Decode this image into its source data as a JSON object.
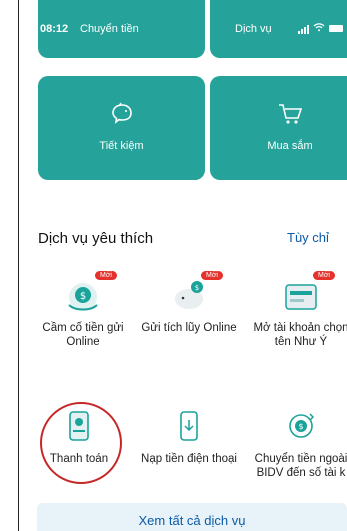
{
  "status_bar": {
    "time": "08:12",
    "left_app": "Chuyển tiền",
    "right_app": "Dịch vụ"
  },
  "tiles": [
    {
      "label": "Tiết kiệm",
      "icon": "piggy-bank-icon"
    },
    {
      "label": "Mua sắm",
      "icon": "shopping-cart-icon"
    }
  ],
  "favorites": {
    "title": "Dịch vụ yêu thích",
    "customize_label": "Tùy chỉ",
    "items": [
      {
        "label": "Cầm cố tiền gửi Online",
        "badge": "Mới",
        "icon": "coin-hand-icon"
      },
      {
        "label": "Gửi tích lũy Online",
        "badge": "Mới",
        "icon": "savings-pig-icon"
      },
      {
        "label": "Mở tài khoản chọn tên Như Ý",
        "badge": "Mới",
        "icon": "card-account-icon"
      },
      {
        "label": "Thanh toán",
        "icon": "payment-icon"
      },
      {
        "label": "Nạp tiền điện thoại",
        "icon": "phone-topup-icon"
      },
      {
        "label": "Chuyển tiền ngoài BIDV đến số tài k",
        "icon": "transfer-icon"
      }
    ]
  },
  "see_all_label": "Xem tất cả dịch vụ",
  "colors": {
    "tile": "#25a39a",
    "accent": "#0b5aa8",
    "badge": "#e5322d",
    "highlight_circle": "#c62828"
  }
}
